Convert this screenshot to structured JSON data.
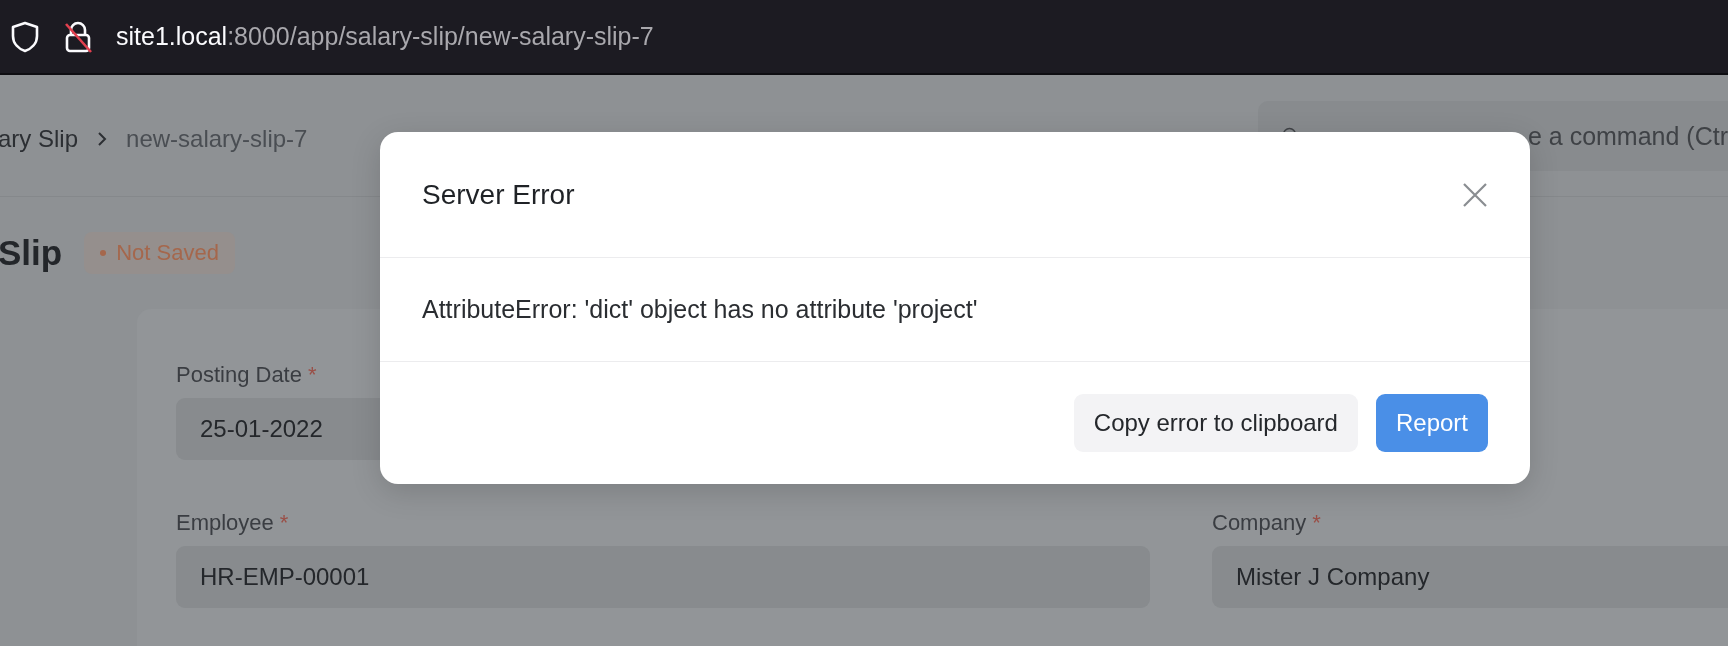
{
  "browser": {
    "url_host": "site1.local",
    "url_path": ":8000/app/salary-slip/new-salary-slip-7"
  },
  "breadcrumbs": [
    "ary Slip",
    "new-salary-slip-7"
  ],
  "search": {
    "placeholder": "e a command (Ctr"
  },
  "page": {
    "title": "Slip",
    "status": "Not Saved"
  },
  "form": {
    "columns": [
      {
        "fields": [
          {
            "label": "Posting Date",
            "required_mark": "*",
            "value": "25-01-2022"
          },
          {
            "label": "Employee",
            "required_mark": "*",
            "value": "HR-EMP-00001"
          }
        ]
      },
      {
        "fields": [
          {
            "label": "Company",
            "required_mark": "*",
            "value": "Mister J Company"
          }
        ]
      }
    ]
  },
  "dialog": {
    "title": "Server Error",
    "message": "AttributeError: 'dict' object has no attribute 'project'",
    "buttons": [
      {
        "label": "Copy error to clipboard",
        "kind": "secondary"
      },
      {
        "label": "Report",
        "kind": "primary"
      }
    ]
  }
}
